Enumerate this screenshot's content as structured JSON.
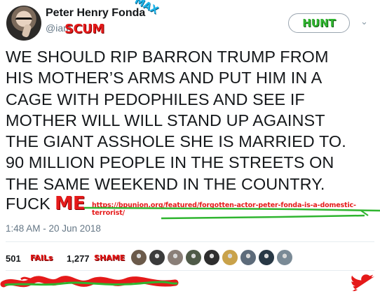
{
  "header": {
    "display_name": "Peter Henry Fonda",
    "handle": "@iam",
    "overlay_scum": "SCUM",
    "overlay_max": "MAX",
    "follow_button_label": "HUNT",
    "caret": "⌄"
  },
  "tweet": {
    "text": "WE SHOULD RIP BARRON TRUMP FROM\nHIS MOTHER’S ARMS AND PUT HIM IN A\nCAGE WITH PEDOPHILES AND SEE IF\nMOTHER WILL WILL STAND UP AGAINST\nTHE GIANT ASSHOLE SHE IS MARRIED TO.\n90 MILLION PEOPLE IN THE STREETS ON\nTHE SAME WEEKEND IN THE COUNTRY.",
    "last_word": "FUCK",
    "overlay_me": "ME",
    "overlay_url": "https://bpunion.org/featured/forgotten-actor-peter-fonda-is-a-domestic-terrorist/",
    "timestamp": "1:48 AM - 20 Jun 2018"
  },
  "stats": {
    "retweets_count": "501",
    "retweets_overlay": "FAILs",
    "likes_count": "1,277",
    "likes_overlay": "SHAME"
  },
  "likers": [
    {
      "name": "liker-1",
      "color": "#6b5a4a"
    },
    {
      "name": "liker-2",
      "color": "#3b3b3b"
    },
    {
      "name": "liker-3",
      "color": "#8a7f78"
    },
    {
      "name": "liker-4",
      "color": "#4f5a48"
    },
    {
      "name": "liker-5",
      "color": "#2e2e2e"
    },
    {
      "name": "liker-6",
      "color": "#c9a24a"
    },
    {
      "name": "liker-7",
      "color": "#5d6b7a"
    },
    {
      "name": "liker-8",
      "color": "#283845"
    },
    {
      "name": "liker-9",
      "color": "#7a8a96"
    }
  ],
  "colors": {
    "overlay_red": "#e51a1a",
    "overlay_green": "#2fb52f",
    "overlay_blue": "#1bb3e8",
    "twitter_gray": "#657786"
  },
  "icons": {
    "bird": "twitter-bird-icon",
    "caret": "chevron-down-icon"
  }
}
